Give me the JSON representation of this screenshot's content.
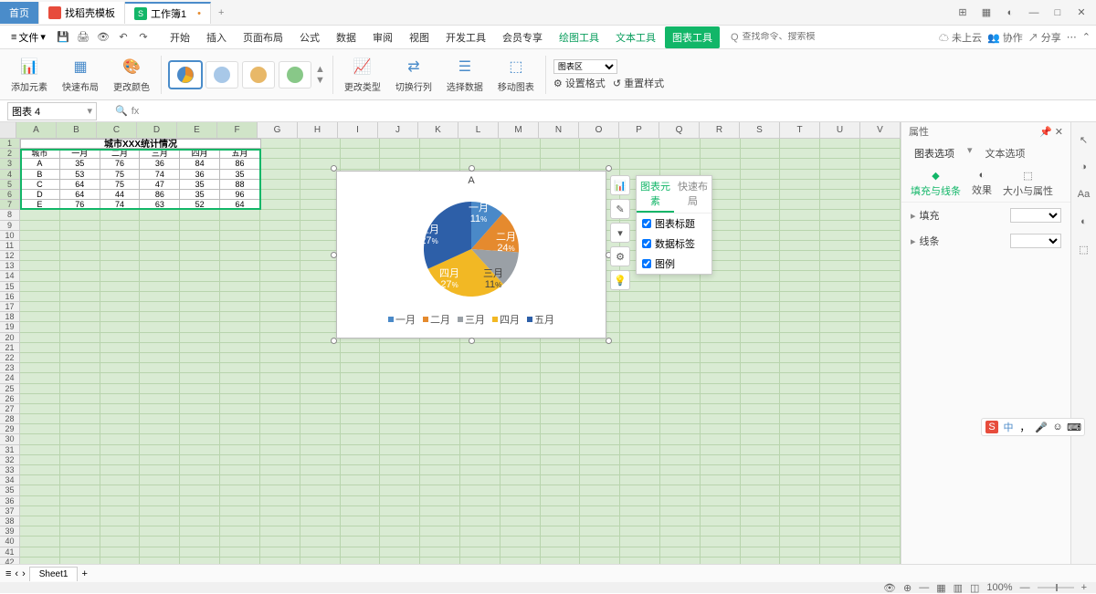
{
  "titlebar": {
    "tabs": [
      {
        "label": "首页",
        "type": "home"
      },
      {
        "label": "找稻壳模板",
        "type": "doc"
      },
      {
        "label": "工作簿1",
        "type": "active",
        "dirty": true
      }
    ]
  },
  "menubar": {
    "file": "文件",
    "tabs": [
      "开始",
      "插入",
      "页面布局",
      "公式",
      "数据",
      "审阅",
      "视图",
      "开发工具",
      "会员专享"
    ],
    "tool_tabs": [
      "绘图工具",
      "文本工具"
    ],
    "active_tab": "图表工具",
    "search_icon": "Q",
    "search_placeholder": "查找命令、搜索模板",
    "cloud": "未上云",
    "coop": "协作",
    "share": "分享"
  },
  "ribbon": {
    "g1": {
      "a": "添加元素",
      "b": "快速布局",
      "c": "更改颜色"
    },
    "g2": "更改类型",
    "g3": "切换行列",
    "g4": "选择数据",
    "g5": "移动图表",
    "area_label": "图表区",
    "format": "设置格式",
    "reset": "重置样式"
  },
  "formula_bar": {
    "namebox": "图表 4",
    "fx": "fx"
  },
  "columns": [
    "A",
    "B",
    "C",
    "D",
    "E",
    "F",
    "G",
    "H",
    "I",
    "J",
    "K",
    "L",
    "M",
    "N",
    "O",
    "P",
    "Q",
    "R",
    "S",
    "T",
    "U",
    "V"
  ],
  "row_count": 43,
  "table": {
    "title": "城市XXX统计情况",
    "headers": [
      "城市",
      "一月",
      "二月",
      "三月",
      "四月",
      "五月"
    ],
    "rows": [
      [
        "A",
        "35",
        "76",
        "36",
        "84",
        "86"
      ],
      [
        "B",
        "53",
        "75",
        "74",
        "36",
        "35"
      ],
      [
        "C",
        "64",
        "75",
        "47",
        "35",
        "88"
      ],
      [
        "D",
        "64",
        "44",
        "86",
        "35",
        "96"
      ],
      [
        "E",
        "76",
        "74",
        "63",
        "52",
        "64"
      ]
    ]
  },
  "chart_data": {
    "type": "pie",
    "title": "A",
    "categories": [
      "一月",
      "二月",
      "三月",
      "四月",
      "五月"
    ],
    "values": [
      35,
      76,
      36,
      84,
      86
    ],
    "percentages": [
      11,
      24,
      11,
      27,
      27
    ],
    "colors": [
      "#4a89c8",
      "#e58a2e",
      "#9aa0a6",
      "#f2b824",
      "#2d5fa8"
    ],
    "legend_position": "bottom"
  },
  "chart_popup": {
    "tab1": "图表元素",
    "tab2": "快速布局",
    "items": [
      "图表标题",
      "数据标签",
      "图例"
    ]
  },
  "props": {
    "title": "属性",
    "tab1": "图表选项",
    "tab2": "文本选项",
    "icons": [
      "填充与线条",
      "效果",
      "大小与属性"
    ],
    "sec1": "填充",
    "sec2": "线条"
  },
  "sheet": {
    "name": "Sheet1"
  },
  "statusbar": {
    "zoom": "100%"
  },
  "ime": {
    "brand": "S",
    "lang": "中"
  }
}
